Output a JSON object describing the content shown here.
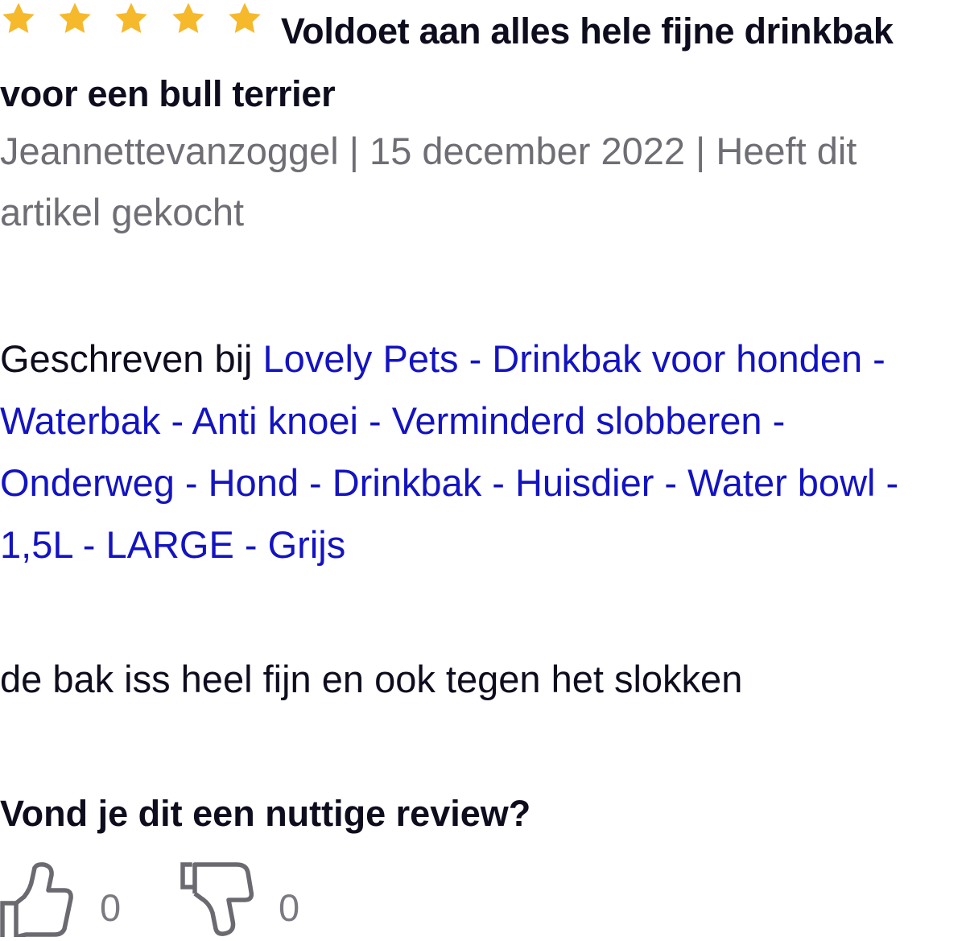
{
  "review": {
    "rating": 5,
    "rating_max": 5,
    "star_color": "#f5b92b",
    "title": "Voldoet aan alles hele fijne drinkbak voor een bull terrier",
    "meta": "Jeannettevanzoggel | 15 december 2022 | Heeft dit artikel gekocht",
    "written_for_prefix": "Geschreven bij ",
    "product_link": "Lovely Pets - Drinkbak voor honden - Waterbak - Anti knoei - Verminderd slobberen - Onderweg - Hond - Drinkbak - Huisdier - Water bowl - 1,5L - LARGE - Grijs",
    "body": "de bak iss heel fijn en ook tegen het slokken"
  },
  "feedback": {
    "question": "Vond je dit een nuttige review?",
    "thumbs_up_icon": "thumbs-up-icon",
    "thumbs_down_icon": "thumbs-down-icon",
    "helpful_count": "0",
    "not_helpful_count": "0"
  },
  "colors": {
    "text": "#0d0d1e",
    "muted": "#6e6e74",
    "link": "#1313c2"
  }
}
